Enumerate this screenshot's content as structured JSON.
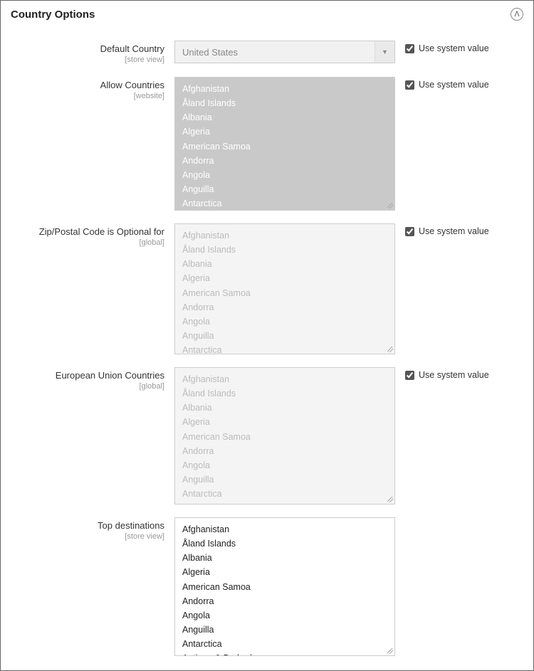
{
  "panel_title": "Country Options",
  "use_system_value_label": "Use system value",
  "countries_list": [
    "Afghanistan",
    "Åland Islands",
    "Albania",
    "Algeria",
    "American Samoa",
    "Andorra",
    "Angola",
    "Anguilla",
    "Antarctica",
    "Antigua & Barbuda"
  ],
  "fields": {
    "default_country": {
      "label": "Default Country",
      "scope": "[store view]",
      "value": "United States",
      "use_system": true
    },
    "allow_countries": {
      "label": "Allow Countries",
      "scope": "[website]",
      "use_system": true
    },
    "zip_optional": {
      "label": "Zip/Postal Code is Optional for",
      "scope": "[global]",
      "use_system": true
    },
    "eu_countries": {
      "label": "European Union Countries",
      "scope": "[global]",
      "use_system": true
    },
    "top_destinations": {
      "label": "Top destinations",
      "scope": "[store view]",
      "use_system": false
    }
  }
}
